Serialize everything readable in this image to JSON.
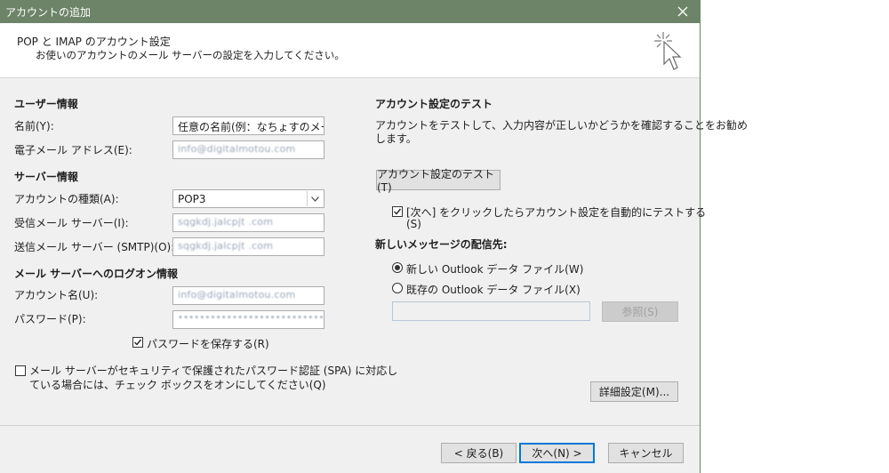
{
  "window": {
    "title": "アカウントの追加"
  },
  "header": {
    "heading": "POP と IMAP のアカウント設定",
    "subheading": "お使いのアカウントのメール サーバーの設定を入力してください。"
  },
  "user_info": {
    "section": "ユーザー情報",
    "name_label": "名前(Y):",
    "name_value": "任意の名前(例：なちょすのメール)",
    "email_label": "電子メール アドレス(E):",
    "email_value": "info@digitalmotou.com"
  },
  "server_info": {
    "section": "サーバー情報",
    "account_type_label": "アカウントの種類(A):",
    "account_type_value": "POP3",
    "incoming_label": "受信メール サーバー(I):",
    "incoming_value": "sqgkdj.jalcpjt .com",
    "outgoing_label": "送信メール サーバー (SMTP)(O):",
    "outgoing_value": "sqgkdj.jalcpjt .com"
  },
  "logon_info": {
    "section": "メール サーバーへのログオン情報",
    "account_name_label": "アカウント名(U):",
    "account_name_value": "info@digitalmotou.com",
    "password_label": "パスワード(P):",
    "password_value": "••••••••••••••••••••••••••••",
    "save_password_label": "パスワードを保存する(R)",
    "save_password_checked": true
  },
  "spa": {
    "line1": "メール サーバーがセキュリティで保護されたパスワード認証 (SPA) に対応し",
    "line2": "ている場合には、チェック ボックスをオンにしてください(Q)",
    "checked": false
  },
  "test": {
    "section": "アカウント設定のテスト",
    "desc_line1": "アカウントをテストして、入力内容が正しいかどうかを確認することをお勧め",
    "desc_line2": "します。",
    "test_button": "アカウント設定のテスト(T)",
    "auto_test_line1": "[次へ] をクリックしたらアカウント設定を自動的にテストする",
    "auto_test_line2": "(S)",
    "auto_test_checked": true
  },
  "delivery": {
    "section": "新しいメッセージの配信先:",
    "new_file_label": "新しい Outlook データ ファイル(W)",
    "existing_file_label": "既存の Outlook データ ファイル(X)",
    "selected": "new",
    "existing_path_value": "",
    "browse_button": "参照(S)"
  },
  "advanced_button": "詳細設定(M)...",
  "footer": {
    "back_button": "< 戻る(B)",
    "next_button": "次へ(N) >",
    "cancel_button": "キャンセル"
  },
  "icons": {
    "close": "close-icon",
    "wizard": "wizard-cursor-icon",
    "dropdown": "chevron-down-icon",
    "check": "checkmark-icon"
  },
  "colors": {
    "titlebar": "#6d8468",
    "dialog_bg": "#f0f0f0",
    "focus": "#0078d7"
  }
}
